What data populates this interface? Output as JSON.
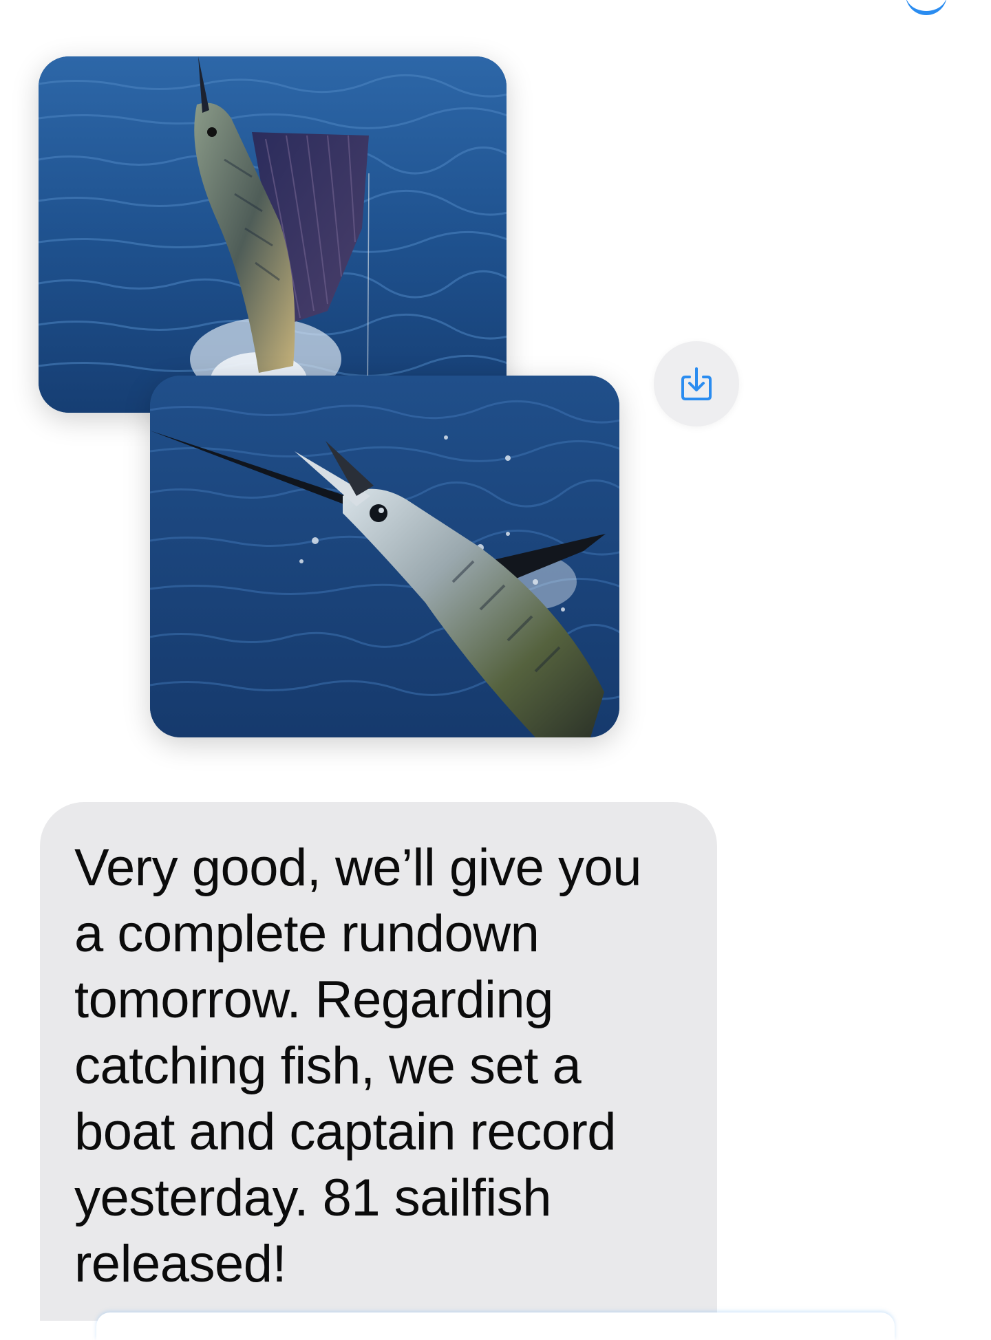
{
  "thread": {
    "photos": [
      {
        "name": "sailfish-jumping-photo"
      },
      {
        "name": "sailfish-leaping-photo"
      }
    ],
    "share_button": {
      "icon": "square-and-arrow-down-icon",
      "color": "#2a8cf0"
    },
    "message": {
      "text": "Very good, we’ll give you\na complete rundown\ntomorrow.   Regarding\ncatching fish, we set a\nboat and captain record\nyesterday.   81 sailfish\nreleased!",
      "bubble_color": "#e9e9eb"
    }
  }
}
